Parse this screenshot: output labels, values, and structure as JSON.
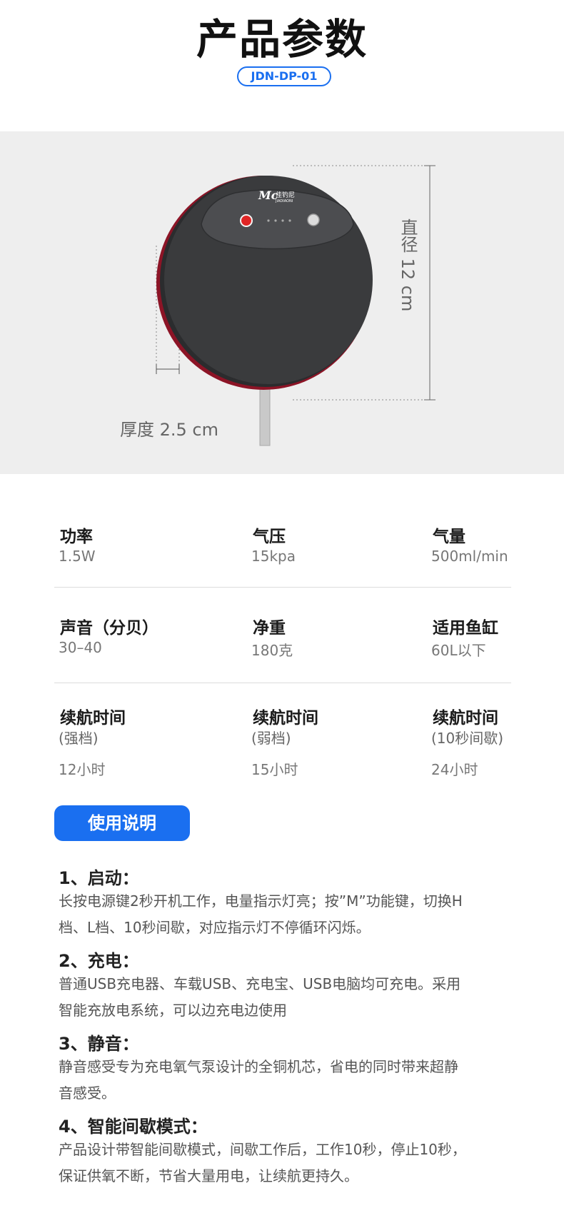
{
  "header": {
    "title": "产品参数",
    "model": "JDN-DP-01"
  },
  "product": {
    "brand_mark": "Mc",
    "brand_name": "佳钓尼",
    "brand_sub": "JIADIAONI",
    "diameter_label": "直径 12 cm",
    "thickness_label": "厚度 2.5 cm",
    "colors": {
      "body": "#3a3b3d",
      "rim": "#a3152a",
      "indicator": "#e02525"
    }
  },
  "specs": {
    "row1": [
      {
        "label": "功率",
        "value": "1.5W"
      },
      {
        "label": "气压",
        "value": "15kpa"
      },
      {
        "label": "气量",
        "value": "500ml/min"
      }
    ],
    "row2": [
      {
        "label": "声音（分贝）",
        "value": "30–40"
      },
      {
        "label": "净重",
        "value": "180克"
      },
      {
        "label": "适用鱼缸",
        "value": "60L以下"
      }
    ],
    "row3": [
      {
        "label": "续航时间",
        "sub": "(强档)",
        "value": "12小时"
      },
      {
        "label": "续航时间",
        "sub": "(弱档)",
        "value": "15小时"
      },
      {
        "label": "续航时间",
        "sub": "(10秒间歇)",
        "value": "24小时"
      }
    ]
  },
  "usage": {
    "button_label": "使用说明",
    "steps": [
      {
        "heading": "1、启动：",
        "lines": [
          "长按电源键2秒开机工作，电量指示灯亮；按”M”功能键，切换H",
          "档、L档、10秒间歇，对应指示灯不停循环闪烁。"
        ]
      },
      {
        "heading": "2、充电：",
        "lines": [
          "普通USB充电器、车载USB、充电宝、USB电脑均可充电。采用",
          "智能充放电系统，可以边充电边使用"
        ]
      },
      {
        "heading": "3、静音：",
        "lines": [
          "静音感受专为充电氧气泵设计的全铜机芯，省电的同时带来超静",
          "音感受。"
        ]
      },
      {
        "heading": "4、智能间歇模式：",
        "lines": [
          "产品设计带智能间歇模式，间歇工作后，工作10秒，停止10秒，",
          "保证供氧不断，节省大量用电，让续航更持久。"
        ]
      }
    ]
  },
  "colors": {
    "accent": "#1a6ff0",
    "product_bg": "#eeeeee"
  }
}
